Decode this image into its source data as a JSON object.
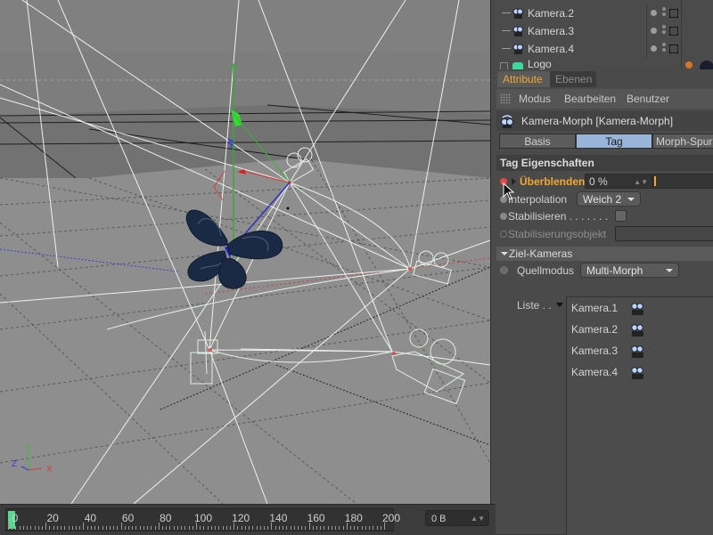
{
  "object_manager": {
    "rows": [
      {
        "name": "Kamera.2",
        "icon": "camera-icon"
      },
      {
        "name": "Kamera.3",
        "icon": "camera-icon"
      },
      {
        "name": "Kamera.4",
        "icon": "camera-icon"
      },
      {
        "name": "Logo",
        "icon": "null-object-icon"
      }
    ]
  },
  "attribute_manager": {
    "tabs": [
      {
        "label": "Attribute",
        "active": true
      },
      {
        "label": "Ebenen",
        "active": false
      }
    ],
    "menu": [
      "Modus",
      "Bearbeiten",
      "Benutzer"
    ],
    "object_title": "Kamera-Morph [Kamera-Morph]",
    "subtabs": [
      {
        "label": "Basis",
        "active": false
      },
      {
        "label": "Tag",
        "active": true
      },
      {
        "label": "Morph-Spur",
        "active": false
      }
    ],
    "section_title": "Tag Eigenschaften",
    "properties": {
      "blend_label": "Überblenden",
      "blend_value": "0 %",
      "blend_fraction": 0,
      "interpolation_label": "Interpolation",
      "interpolation_value": "Weich 2",
      "stabilize_label": "Stabilisieren . . . . . . .",
      "stabilize_checked": false,
      "stabilize_object_label": "Stabilisierungsobjekt",
      "stabilize_object_value": ""
    },
    "target_section": "Ziel-Kameras",
    "source_mode_label": "Quellmodus",
    "source_mode_value": "Multi-Morph",
    "list_label": "Liste . .",
    "list_items": [
      "Kamera.1",
      "Kamera.2",
      "Kamera.3",
      "Kamera.4"
    ]
  },
  "timeline": {
    "ticks": [
      "0",
      "20",
      "40",
      "60",
      "80",
      "100",
      "120",
      "140",
      "160",
      "180",
      "200"
    ],
    "current_frame": "0 B",
    "playhead_frame": 0
  },
  "viewport": {
    "axis_labels": {
      "x": "X",
      "y": "Y",
      "z": "Z"
    }
  },
  "colors": {
    "accent_orange": "#f0a830",
    "active_subtab": "#98b4d8",
    "keyframe_red": "#e34a4a",
    "playhead_green": "#57d98f"
  }
}
